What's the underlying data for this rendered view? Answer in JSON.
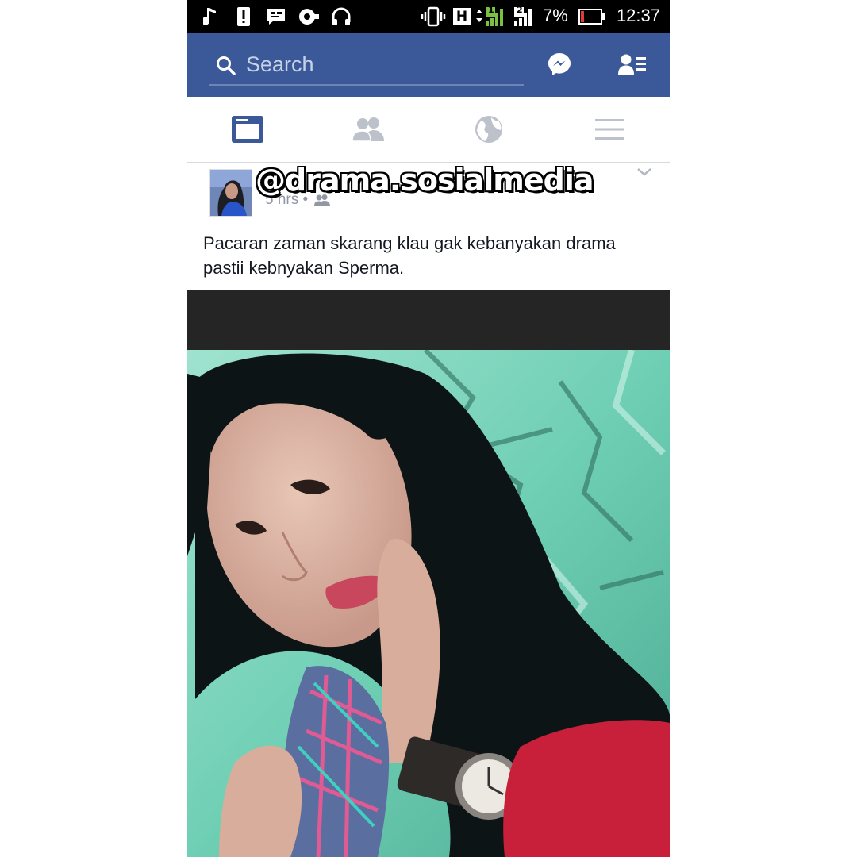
{
  "status_bar": {
    "battery_percent": "7%",
    "time": "12:37",
    "network_type": "H",
    "sim1_label": "1",
    "sim2_label": "2",
    "icons": [
      "music-note-icon",
      "alert-icon",
      "chat-bubble-icon",
      "eye-icon",
      "headset-icon",
      "vibrate-icon",
      "signal-icon",
      "battery-icon"
    ]
  },
  "header": {
    "search_placeholder": "Search",
    "brand_color": "#3b5998",
    "icons": [
      "search-icon",
      "messenger-icon",
      "friend-requests-icon"
    ]
  },
  "tabs": [
    {
      "name": "news-feed",
      "icon": "news-feed-icon",
      "active": true
    },
    {
      "name": "friends",
      "icon": "friends-icon",
      "active": false
    },
    {
      "name": "notifications",
      "icon": "globe-icon",
      "active": false
    },
    {
      "name": "menu",
      "icon": "menu-icon",
      "active": false
    }
  ],
  "post": {
    "watermark": "@drama.sosialmedia",
    "time": "5 hrs •",
    "audience_icon": "friends-audience-icon",
    "text": "Pacaran zaman skarang klau gak kebanyakan drama pastii kebnyakan Sperma."
  }
}
